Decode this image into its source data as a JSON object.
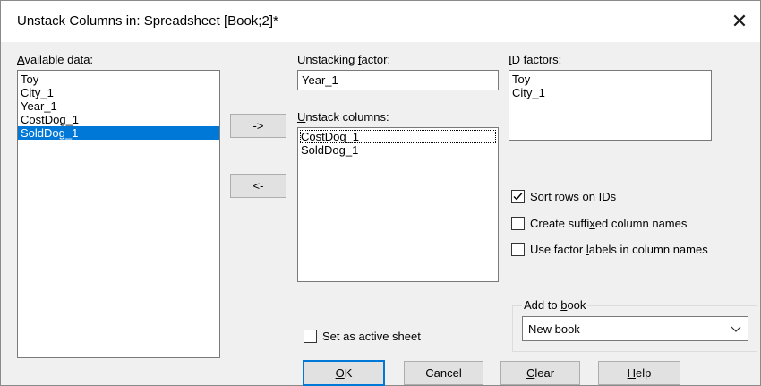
{
  "window": {
    "title": "Unstack Columns in: Spreadsheet [Book;2]*",
    "close_glyph": "✕"
  },
  "available": {
    "label_u": "A",
    "label_rest": "vailable data:",
    "items": [
      "Toy",
      "City_1",
      "Year_1",
      "CostDog_1",
      "SoldDog_1"
    ],
    "selected_index": 4
  },
  "move_buttons": {
    "add_label": "->",
    "remove_label": "<-"
  },
  "unstacking_factor": {
    "label_pre": "Unstacking ",
    "label_u": "f",
    "label_post": "actor:",
    "value": "Year_1"
  },
  "unstack_columns": {
    "label_u": "U",
    "label_rest": "nstack columns:",
    "items": [
      "CostDog_1",
      "SoldDog_1"
    ],
    "focused_index": 0
  },
  "id_factors": {
    "label_u": "I",
    "label_rest": "D factors:",
    "items": [
      "Toy",
      "City_1"
    ]
  },
  "options": {
    "sort_rows": {
      "label_u": "S",
      "label_rest": "ort rows on IDs",
      "checked": true
    },
    "suffixed": {
      "label_pre": "Create suffi",
      "label_u": "x",
      "label_post": "ed column names",
      "checked": false
    },
    "factor_labels": {
      "label_pre": "Use factor ",
      "label_u": "l",
      "label_post": "abels in column names",
      "checked": false
    }
  },
  "add_to_book": {
    "legend_pre": "Add to ",
    "legend_u": "b",
    "legend_post": "ook",
    "selected": "New book"
  },
  "active_sheet": {
    "label": "Set as active sheet",
    "checked": false
  },
  "footer": {
    "ok_u": "O",
    "ok_rest": "K",
    "cancel": "Cancel",
    "clear_u": "C",
    "clear_rest": "lear",
    "help_u": "H",
    "help_rest": "elp"
  },
  "colors": {
    "selection": "#0078d7",
    "dialog_bg": "#f0f0f0",
    "button_bg": "#e1e1e1"
  }
}
